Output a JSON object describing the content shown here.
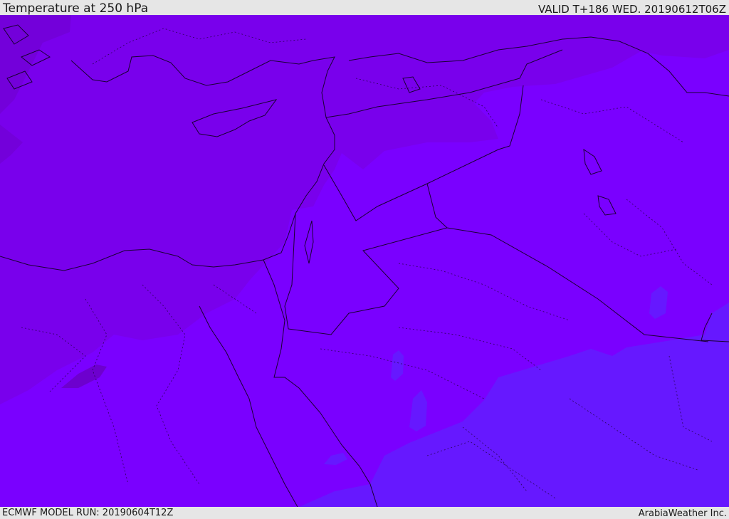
{
  "header": {
    "title": "Temperature at 250 hPa",
    "valid": "VALID T+186 WED. 20190612T06Z"
  },
  "footer": {
    "model_run": "ECMWF MODEL RUN: 20190604T12Z",
    "credit": "ArabiaWeather Inc."
  },
  "map": {
    "fill_colors": {
      "coldest": "#7300da",
      "cold": "#7900ec",
      "mid": "#7a00ff",
      "warm": "#6618ff",
      "spot": "#6d00ce"
    },
    "coastline_color": "#1a0033",
    "border_color": "#1a0033"
  }
}
